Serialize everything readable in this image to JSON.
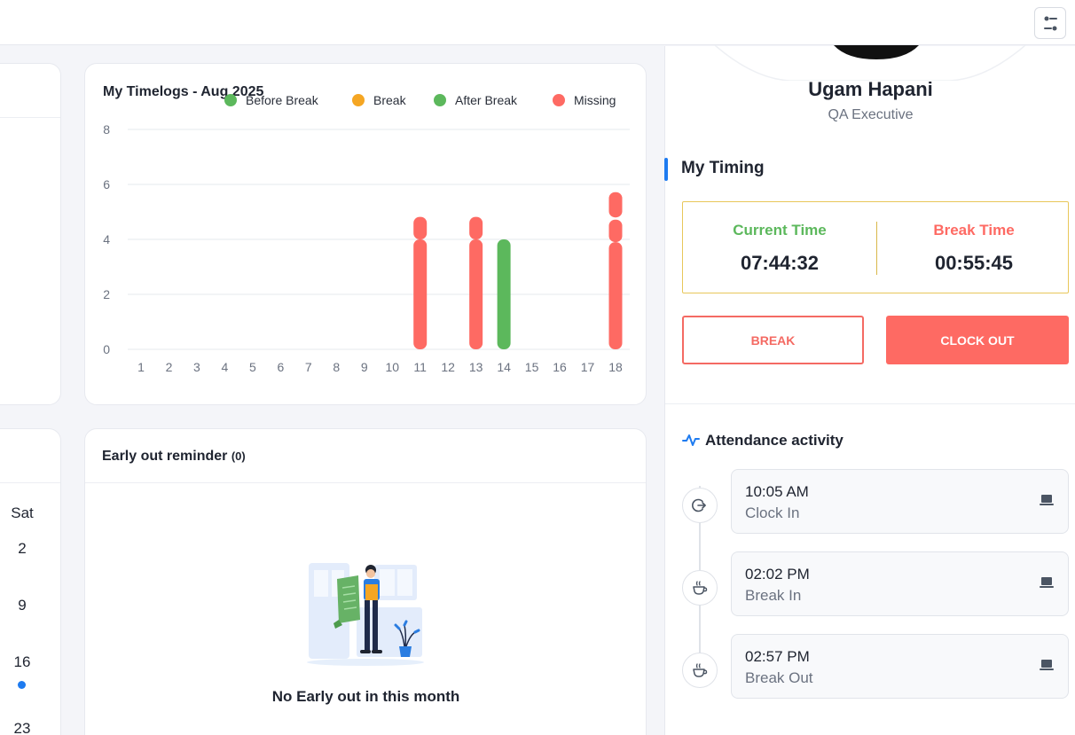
{
  "topbar": {
    "filter_icon": "sliders-icon"
  },
  "chart_card": {
    "title": "My Timelogs - Aug 2025"
  },
  "chart_data": {
    "type": "bar",
    "title": "My Timelogs - Aug 2025",
    "stacked": true,
    "categories": [
      "1",
      "2",
      "3",
      "4",
      "5",
      "6",
      "7",
      "8",
      "9",
      "10",
      "11",
      "12",
      "13",
      "14",
      "15",
      "16",
      "17",
      "18"
    ],
    "legend": [
      {
        "name": "Before Break",
        "color": "#5cb85c"
      },
      {
        "name": "Break",
        "color": "#f5a623"
      },
      {
        "name": "After Break",
        "color": "#5cb85c"
      },
      {
        "name": "Missing",
        "color": "#fe6a63"
      }
    ],
    "series": [
      {
        "name": "Before Break",
        "color": "#5cb85c",
        "values": [
          0,
          0,
          0,
          0,
          0,
          0,
          0,
          0,
          0,
          0,
          0,
          0,
          0,
          4.0,
          0,
          0,
          0,
          0
        ]
      },
      {
        "name": "Break",
        "color": "#f5a623",
        "values": [
          0,
          0,
          0,
          0,
          0,
          0,
          0,
          0,
          0,
          0,
          0,
          0,
          0,
          0,
          0,
          0,
          0,
          0
        ]
      },
      {
        "name": "After Break",
        "color": "#5cb85c",
        "values": [
          0,
          0,
          0,
          0,
          0,
          0,
          0,
          0,
          0,
          0,
          0,
          0,
          0,
          0,
          0,
          0,
          0,
          0
        ]
      },
      {
        "name": "Missing",
        "color": "#fe6a63",
        "segments": [
          [],
          [],
          [],
          [],
          [],
          [],
          [],
          [],
          [],
          [],
          [
            4.0,
            0.9
          ],
          [],
          [
            4.0,
            0.9
          ],
          [],
          [],
          [],
          [],
          [
            3.9,
            0.9,
            1.0
          ]
        ]
      }
    ],
    "y_ticks": [
      "0",
      "2",
      "4",
      "6",
      "8"
    ],
    "ylim": [
      0,
      8
    ],
    "grid": true,
    "legend_position": "top"
  },
  "early_out": {
    "title": "Early out reminder",
    "count": "(0)",
    "empty_text": "No Early out in this month"
  },
  "calendar": {
    "header": "Sat",
    "days": [
      "2",
      "9",
      "16",
      "23"
    ]
  },
  "profile": {
    "name": "Ugam Hapani",
    "role": "QA Executive"
  },
  "timing": {
    "title": "My Timing",
    "current_label": "Current Time",
    "current_value": "07:44:32",
    "current_color": "#5cb85c",
    "break_label": "Break Time",
    "break_value": "00:55:45",
    "break_color": "#fe6a63",
    "break_button": "BREAK",
    "clockout_button": "CLOCK OUT"
  },
  "activity": {
    "title": "Attendance activity",
    "items": [
      {
        "time": "10:05 AM",
        "label": "Clock In",
        "icon": "clock-in-icon",
        "device": "laptop-icon"
      },
      {
        "time": "02:02 PM",
        "label": "Break In",
        "icon": "coffee-icon",
        "device": "laptop-icon"
      },
      {
        "time": "02:57 PM",
        "label": "Break Out",
        "icon": "coffee-icon",
        "device": "laptop-icon"
      }
    ]
  }
}
